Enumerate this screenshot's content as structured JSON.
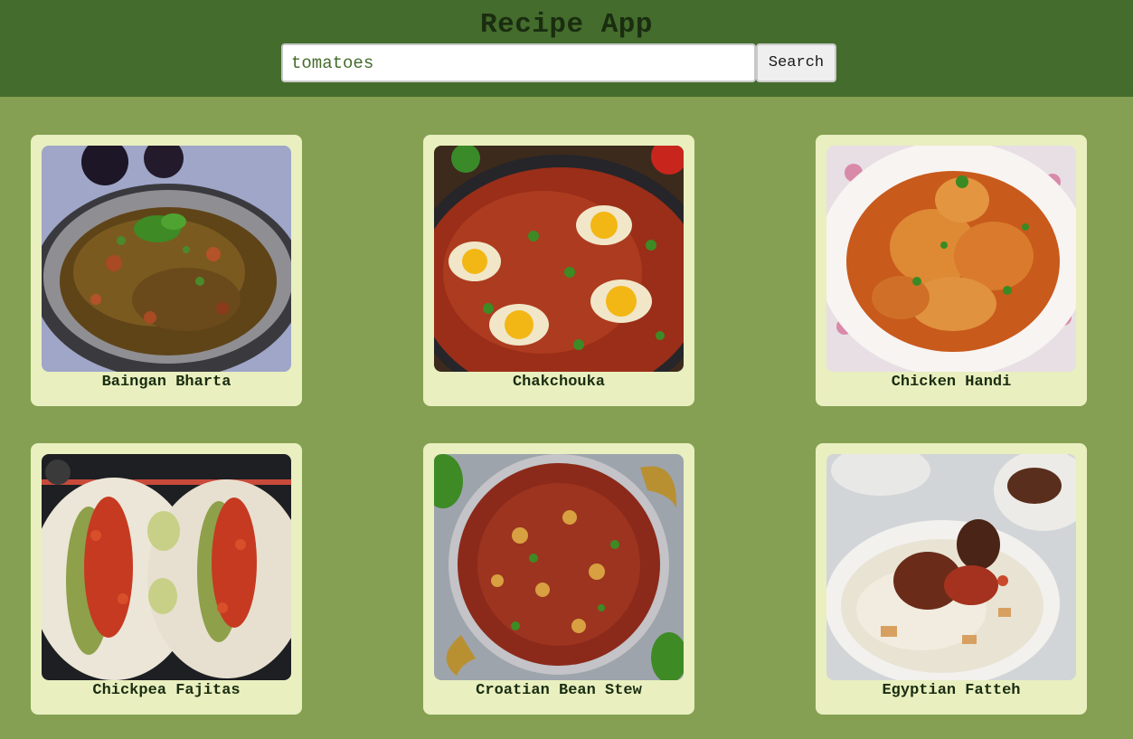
{
  "header": {
    "title": "Recipe App",
    "search_value": "tomatoes",
    "search_button": "Search"
  },
  "recipes": [
    {
      "name": "Baingan Bharta",
      "image": "baingan-bharta-photo"
    },
    {
      "name": "Chakchouka",
      "image": "chakchouka-photo"
    },
    {
      "name": "Chicken Handi",
      "image": "chicken-handi-photo"
    },
    {
      "name": "Chickpea Fajitas",
      "image": "chickpea-fajitas-photo"
    },
    {
      "name": "Croatian Bean Stew",
      "image": "croatian-bean-stew-photo"
    },
    {
      "name": "Egyptian Fatteh",
      "image": "egyptian-fatteh-photo"
    }
  ],
  "colors": {
    "header_bg": "#446c2d",
    "page_bg": "#85a052",
    "card_bg": "#e9efbf",
    "text": "#1a2d10"
  }
}
